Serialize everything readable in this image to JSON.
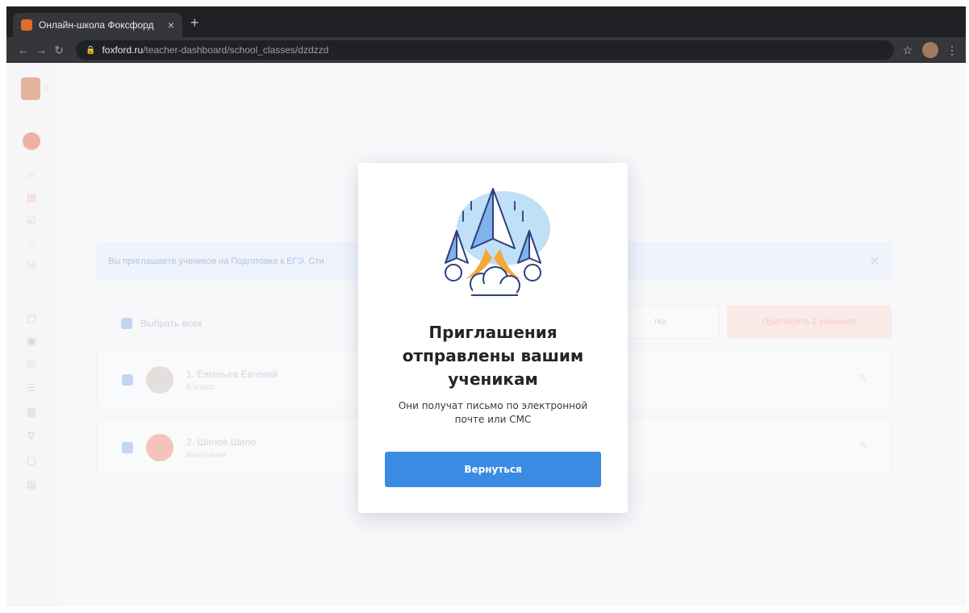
{
  "browser": {
    "tab_title": "Онлайн-школа Фоксфорд",
    "tab_close": "×",
    "new_tab": "+",
    "url_host": "foxford.ru",
    "url_path": "/teacher-dashboard/school_classes/dzdzzd"
  },
  "page": {
    "banner_text": "Вы приглашаете учеников на Подготовка к ЕГЭ. Сти",
    "select_all": "Выбрать всех",
    "outline_button": "тки",
    "invite_button": "Пригласить 2 учеников",
    "students": [
      {
        "name": "1. Евгеньев Евгений",
        "grade": "8 класс"
      },
      {
        "name": "2. Шилов Шило",
        "grade": "Выпускник"
      }
    ]
  },
  "modal": {
    "title": "Приглашения отправлены вашим ученикам",
    "text": "Они получат письмо по электронной почте или СМС",
    "button": "Вернуться"
  },
  "colors": {
    "accent": "#3c8be3",
    "invite": "#fbe2dd"
  }
}
